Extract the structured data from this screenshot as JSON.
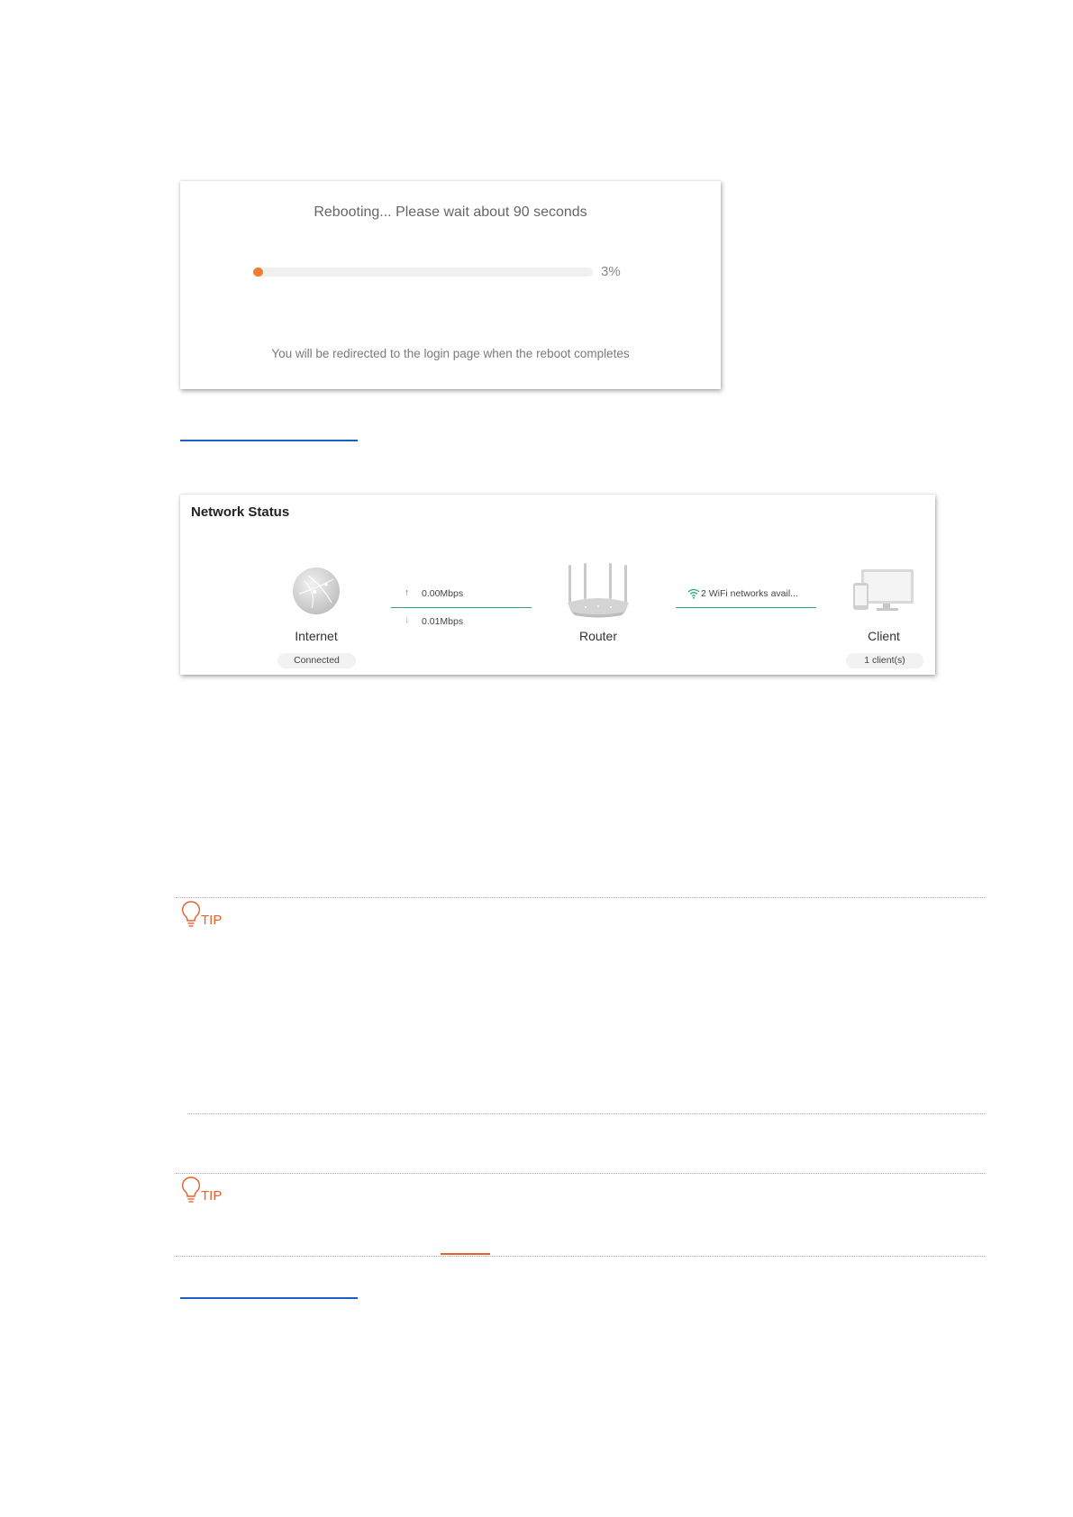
{
  "reboot": {
    "message": "Rebooting... Please wait about 90 seconds",
    "progress_fraction": 0.03,
    "progress_text": "3%",
    "note": "You will be redirected to the login page when the reboot completes"
  },
  "network_status": {
    "title": "Network Status",
    "internet": {
      "label": "Internet",
      "status": "Connected"
    },
    "upload": "0.00Mbps",
    "download": "0.01Mbps",
    "router": {
      "label": "Router"
    },
    "wifi": "2 WiFi networks avail...",
    "client": {
      "label": "Client",
      "count": "1 client(s)"
    }
  },
  "tips": [
    {
      "label": "TIP"
    },
    {
      "label": "TIP"
    }
  ],
  "colors": {
    "accent_orange": "#f47c2c",
    "link_blue": "#1f5fc9",
    "status_green": "#2aa876"
  }
}
